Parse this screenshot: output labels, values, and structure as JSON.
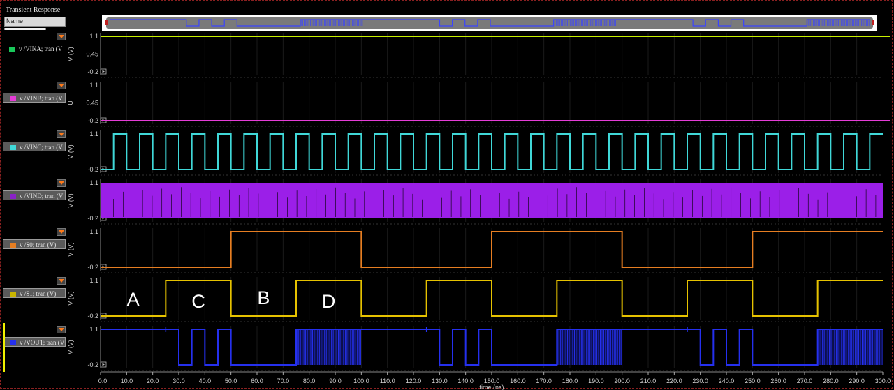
{
  "window": {
    "title": "Transient Response"
  },
  "sidebar": {
    "header": "Name",
    "items": [
      {
        "label": "v /VINA; tran (V",
        "color": "#19c85a",
        "selected": false
      },
      {
        "label": "v /VINB; tran (V",
        "color": "#e43cd6",
        "selected": true
      },
      {
        "label": "v /VINC; tran (V",
        "color": "#40d8d8",
        "selected": true
      },
      {
        "label": "v /VIND; tran (V",
        "color": "#8a22c8",
        "selected": true
      },
      {
        "label": "v /S0; tran (V)",
        "color": "#e67e22",
        "selected": true
      },
      {
        "label": "v /S1; tran (V)",
        "color": "#c8b400",
        "selected": true
      },
      {
        "label": "v /VOUT; tran (V",
        "color": "#2530ee",
        "selected": true
      }
    ]
  },
  "annotations": [
    "A",
    "C",
    "B",
    "D"
  ],
  "chart_data": {
    "type": "line",
    "xlabel": "time (ns)",
    "xlim": [
      0,
      300
    ],
    "x_ticks": [
      "0.0",
      "10.0",
      "20.0",
      "30.0",
      "40.0",
      "50.0",
      "60.0",
      "70.0",
      "80.0",
      "90.0",
      "100.0",
      "110.0",
      "120.0",
      "130.0",
      "140.0",
      "150.0",
      "160.0",
      "170.0",
      "180.0",
      "190.0",
      "200.0",
      "210.0",
      "220.0",
      "230.0",
      "240.0",
      "250.0",
      "260.0",
      "270.0",
      "280.0",
      "290.0",
      "300.0"
    ],
    "panels": [
      {
        "name": "v /VINA; tran (V)",
        "ylabel": "V (V)",
        "y_ticks": [
          "1.1",
          "0.45",
          "-0.2"
        ],
        "ylim": [
          -0.2,
          1.1
        ],
        "color": "#c8f000",
        "kind": "constant",
        "value": 1.1
      },
      {
        "name": "v /VINB; tran (V)",
        "ylabel": "U",
        "y_ticks": [
          "1.1",
          "0.45",
          "-0.2"
        ],
        "ylim": [
          -0.2,
          1.1
        ],
        "color": "#e43cd6",
        "kind": "constant",
        "value": -0.2
      },
      {
        "name": "v /VINC; tran (V)",
        "ylabel": "V (V)",
        "y_ticks": [
          "1.1",
          "-0.2"
        ],
        "ylim": [
          -0.2,
          1.1
        ],
        "color": "#40d8d8",
        "kind": "clock",
        "period_ns": 10,
        "high_first": false
      },
      {
        "name": "v /VIND; tran (V)",
        "ylabel": "V (V)",
        "y_ticks": [
          "1.1",
          "-0.2"
        ],
        "ylim": [
          -0.2,
          1.1
        ],
        "color": "#9b1fe8",
        "kind": "fast_clock"
      },
      {
        "name": "v /S0; tran (V)",
        "ylabel": "V (V)",
        "y_ticks": [
          "1.1",
          "-0.2"
        ],
        "ylim": [
          -0.2,
          1.1
        ],
        "color": "#e67e22",
        "kind": "steps",
        "steps": [
          [
            0,
            -0.2
          ],
          [
            50,
            1.1
          ],
          [
            100,
            -0.2
          ],
          [
            150,
            1.1
          ],
          [
            200,
            -0.2
          ],
          [
            250,
            1.1
          ],
          [
            300,
            1.1
          ]
        ]
      },
      {
        "name": "v /S1; tran (V)",
        "ylabel": "V (V)",
        "y_ticks": [
          "1.1",
          "-0.2"
        ],
        "ylim": [
          -0.2,
          1.1
        ],
        "color": "#e6c200",
        "kind": "steps",
        "steps": [
          [
            0,
            -0.2
          ],
          [
            25,
            1.1
          ],
          [
            50,
            -0.2
          ],
          [
            75,
            1.1
          ],
          [
            100,
            -0.2
          ],
          [
            125,
            1.1
          ],
          [
            150,
            -0.2
          ],
          [
            175,
            1.1
          ],
          [
            200,
            -0.2
          ],
          [
            225,
            1.1
          ],
          [
            250,
            -0.2
          ],
          [
            275,
            1.1
          ],
          [
            300,
            1.1
          ]
        ]
      },
      {
        "name": "v /VOUT; tran (V)",
        "ylabel": "V (V)",
        "y_ticks": [
          "1.1",
          "-0.2"
        ],
        "ylim": [
          -0.2,
          1.1
        ],
        "color": "#2530ee",
        "kind": "vout",
        "steps": [
          [
            0,
            1.1
          ],
          [
            30,
            -0.2
          ],
          [
            35,
            1.1
          ],
          [
            40,
            -0.2
          ],
          [
            45,
            1.1
          ],
          [
            50,
            -0.2
          ],
          [
            75,
            1.1
          ],
          [
            100,
            1.1
          ],
          [
            130,
            -0.2
          ],
          [
            135,
            1.1
          ],
          [
            140,
            -0.2
          ],
          [
            145,
            1.1
          ],
          [
            150,
            -0.2
          ],
          [
            175,
            1.1
          ],
          [
            200,
            1.1
          ],
          [
            230,
            -0.2
          ],
          [
            235,
            1.1
          ],
          [
            240,
            -0.2
          ],
          [
            245,
            1.1
          ],
          [
            250,
            -0.2
          ],
          [
            275,
            1.1
          ],
          [
            300,
            1.1
          ]
        ],
        "noisy_ranges": [
          [
            75,
            100
          ],
          [
            175,
            200
          ],
          [
            275,
            300
          ]
        ]
      }
    ]
  }
}
